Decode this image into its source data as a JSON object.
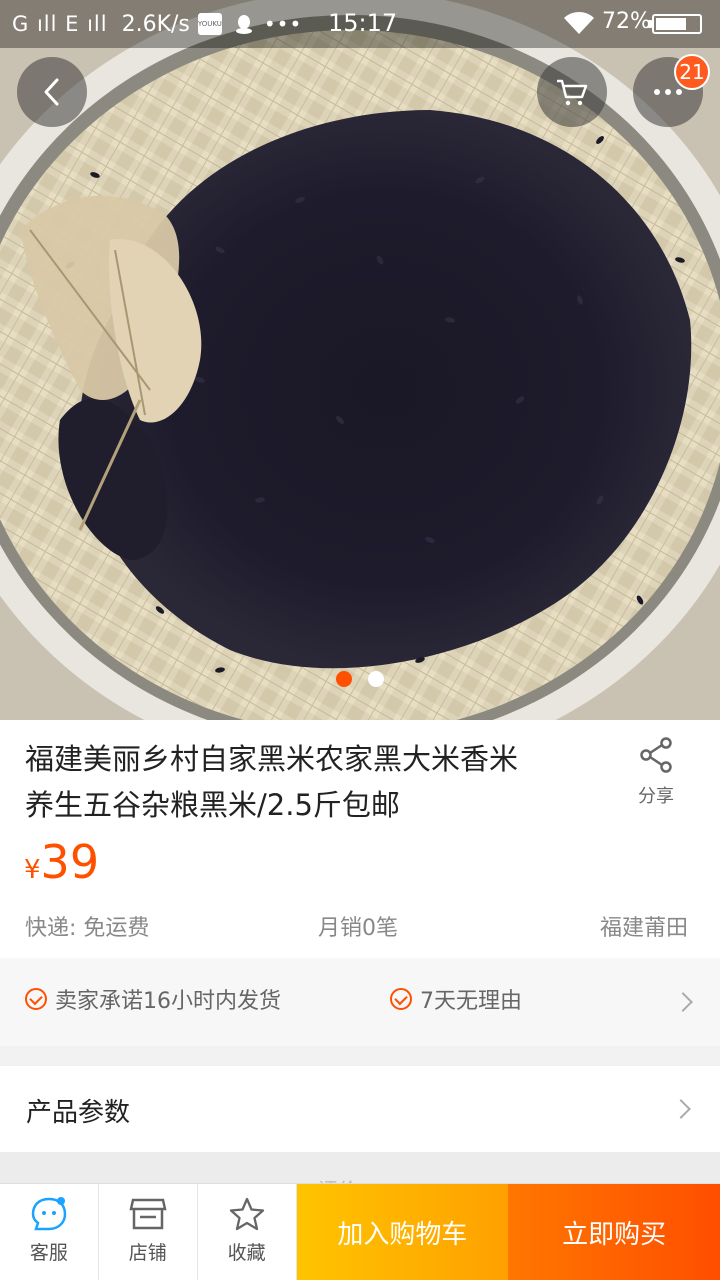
{
  "status_bar": {
    "signal": "G ıll E ıll",
    "speed": "2.6K/s",
    "youku_icon": "YOUKU",
    "more_dots": "•••",
    "time": "15:17",
    "battery_pct": "72%",
    "battery_level": 0.72
  },
  "top_actions": {
    "back_icon": "chevron-left-icon",
    "cart_icon": "cart-icon",
    "more_icon": "more-icon",
    "badge_count": "21"
  },
  "carousel": {
    "total": 2,
    "active": 1
  },
  "product": {
    "title_line1": "福建美丽乡村自家黑米农家黑大米香米",
    "title_line2": "养生五谷杂粮黑米/2.5斤包邮",
    "share_label": "分享",
    "currency": "¥",
    "price": "39",
    "shipping": "快递: 免运费",
    "monthly_sales": "月销0笔",
    "location": "福建莆田"
  },
  "promises": [
    {
      "label": "卖家承诺16小时内发货"
    },
    {
      "label": "7天无理由"
    }
  ],
  "params": {
    "label": "产品参数"
  },
  "peek": {
    "label": "评价"
  },
  "bottom_bar": {
    "service_label": "客服",
    "shop_label": "店铺",
    "favorite_label": "收藏",
    "add_cart_label": "加入购物车",
    "buy_now_label": "立即购买"
  },
  "colors": {
    "accent": "#ff5000",
    "add_cart": "#ffb300",
    "buy_now": "#ff6000"
  }
}
